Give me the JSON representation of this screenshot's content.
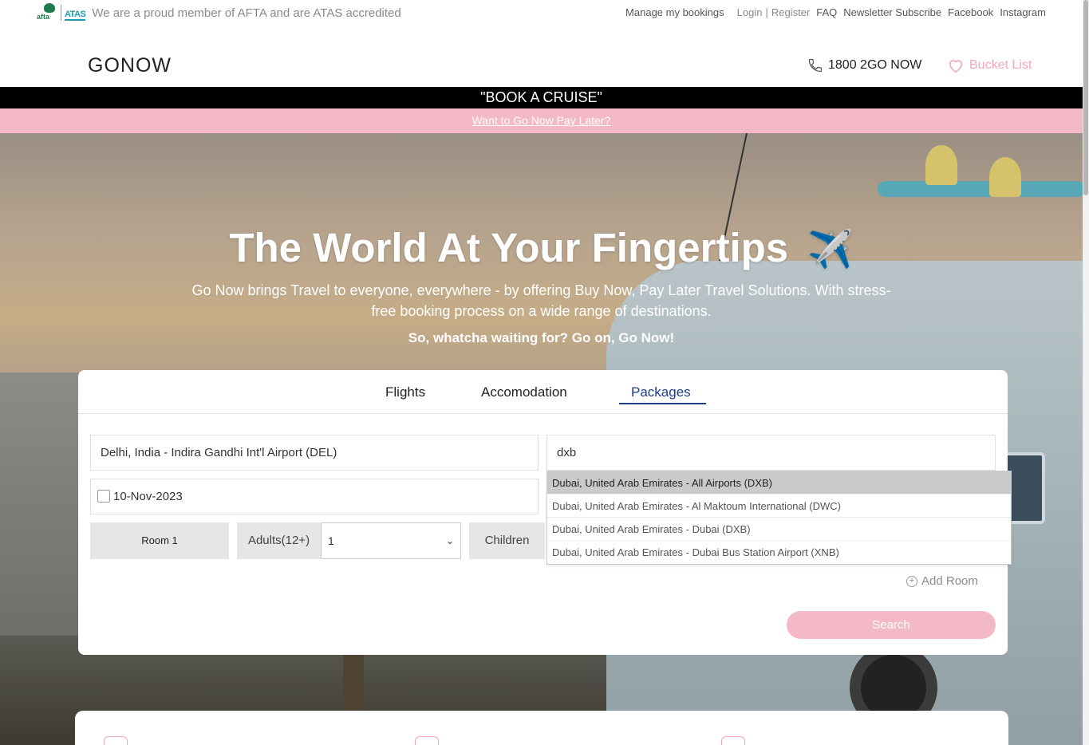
{
  "utility_bar": {
    "afta_logo_text": "afta",
    "atas_logo_text": "ATAS",
    "membership_text": "We are a proud member of AFTA and are ATAS accredited",
    "links": {
      "manage": "Manage my bookings",
      "login": "Login",
      "separator": "|",
      "register": "Register",
      "faq": "FAQ",
      "newsletter": "Newsletter Subscribe",
      "facebook": "Facebook",
      "instagram": "Instagram"
    }
  },
  "header": {
    "brand": "GONOW",
    "phone": "1800 2GO NOW",
    "bucket_list": "Bucket List"
  },
  "banners": {
    "cruise": "\"BOOK A CRUISE\"",
    "pay_later": "Want to Go Now Pay Later?"
  },
  "hero": {
    "title": "The World At Your Fingertips",
    "plane_emoji": "✈️",
    "subtitle": "Go Now brings Travel to everyone, everywhere - by offering Buy Now, Pay Later Travel Solutions. With stress-free booking process on a wide range of destinations.",
    "cta": "So, whatcha waiting for? Go on, Go Now!"
  },
  "search": {
    "tabs": [
      {
        "label": "Flights",
        "active": false
      },
      {
        "label": "Accomodation",
        "active": false
      },
      {
        "label": "Packages",
        "active": true
      }
    ],
    "origin_value": "Delhi, India - Indira Gandhi Int'l Airport (DEL)",
    "destination_value": "dxb",
    "date_value": "10-Nov-2023",
    "room_label": "Room 1",
    "adults_label": "Adults(12+)",
    "adults_value": "1",
    "children_label": "Children",
    "add_room": "Add Room",
    "search_button": "Search",
    "suggestions": [
      "Dubai, United Arab Emirates - All Airports (DXB)",
      "Dubai, United Arab Emirates - Al Maktoum International (DWC)",
      "Dubai, United Arab Emirates - Dubai (DXB)",
      "Dubai, United Arab Emirates - Dubai Bus Station Airport (XNB)"
    ]
  },
  "colors": {
    "accent_pink": "#f4b9c7",
    "active_tab": "#1f3a8a",
    "banner_black": "#000000"
  }
}
